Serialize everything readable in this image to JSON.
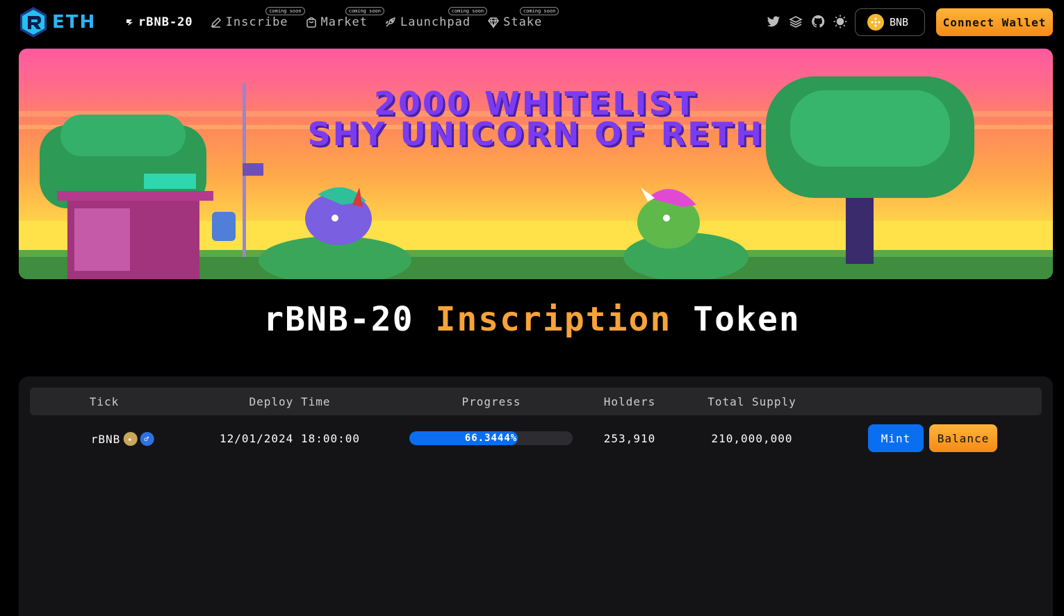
{
  "app": {
    "logo_text": "ETH",
    "logo_icon": "reth-r-logo-icon"
  },
  "nav": {
    "items": [
      {
        "label": "rBNB-20",
        "icon": "reth-mini-icon",
        "active": true,
        "badge": ""
      },
      {
        "label": "Inscribe",
        "icon": "pen-icon",
        "active": false,
        "badge": "coming soon"
      },
      {
        "label": "Market",
        "icon": "bag-icon",
        "active": false,
        "badge": "coming soon"
      },
      {
        "label": "Launchpad",
        "icon": "rocket-icon",
        "active": false,
        "badge": "coming soon"
      },
      {
        "label": "Stake",
        "icon": "diamond-icon",
        "active": false,
        "badge": "coming soon"
      }
    ]
  },
  "social": [
    "twitter-icon",
    "layers-icon",
    "github-icon",
    "sun-icon"
  ],
  "chain": {
    "label": "BNB",
    "icon": "bnb-coin-icon"
  },
  "connect_wallet": {
    "label": "Connect Wallet"
  },
  "banner": {
    "line1": "2000 WHITELIST",
    "line2": "SHY UNICORN OF RETH"
  },
  "title": {
    "part1": "rBNB-20",
    "part2": "Inscription",
    "part3": "Token"
  },
  "table": {
    "headers": [
      "Tick",
      "Deploy Time",
      "Progress",
      "Holders",
      "Total Supply"
    ],
    "rows": [
      {
        "tick": "rBNB",
        "deploy_time": "12/01/2024 18:00:00",
        "progress_label": "66.3444%",
        "progress_value": 66.3444,
        "holders": "253,910",
        "total_supply": "210,000,000",
        "mint_label": "Mint",
        "balance_label": "Balance"
      }
    ]
  },
  "colors": {
    "accent_orange": "#f7a23a",
    "accent_blue": "#0b6ef0",
    "banner_text": "#7a3cf0"
  }
}
